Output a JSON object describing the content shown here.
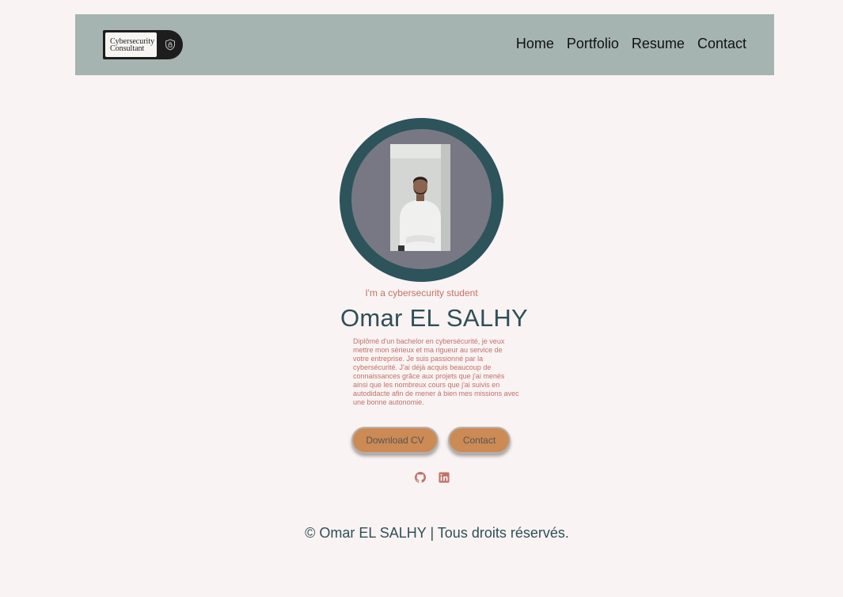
{
  "header": {
    "logo_line1": "Cybersecurity",
    "logo_line2": "Consultant",
    "nav": [
      "Home",
      "Portfolio",
      "Resume",
      "Contact"
    ]
  },
  "hero": {
    "subtitle": "I'm a cybersecurity student",
    "name": "Omar EL SALHY",
    "bio": "Diplômé d'un bachelor en cybersécurité, je veux mettre mon sérieux et ma rigueur au service de votre entreprise. Je suis passionné par la cybersécurité. J'ai déjà acquis beaucoup de connaissances grâce aux projets que j'ai menés ainsi que les nombreux cours que j'ai suivis en autodidacte afin de mener à bien mes missions avec une bonne autonomie.",
    "download_cv": "Download CV",
    "contact": "Contact"
  },
  "social": {
    "github_icon": "github-icon",
    "linkedin_icon": "linkedin-icon"
  },
  "footer": {
    "copyright": "© Omar EL SALHY | Tous droits réservés."
  },
  "colors": {
    "header_bg": "#a5b4b0",
    "page_bg": "#f9f3f3",
    "accent": "#c0726a",
    "dark_teal": "#2d535b",
    "button": "#cc8a55"
  }
}
